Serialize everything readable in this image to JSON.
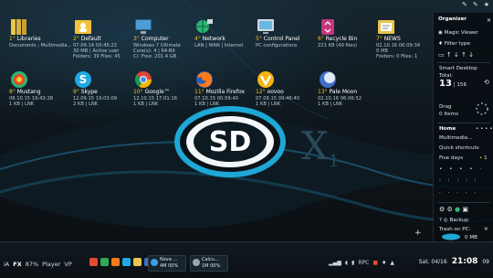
{
  "top_bar": {
    "icons": [
      "pin-icon",
      "pin-icon",
      "star-icon"
    ]
  },
  "desktop_icons": [
    {
      "num": "1°",
      "title": "Libraries",
      "line1": "Documents ; Multimedia...",
      "line2": "",
      "icon": "folder-icon",
      "color": "#e7c64a"
    },
    {
      "num": "2°",
      "title": "Default",
      "line1": "07.09.14  03:45:22",
      "line2": "30 MB  |  Active user",
      "line3": "Folders: 39  Files: 45",
      "icon": "user-folder-icon",
      "color": "#f3c23a"
    },
    {
      "num": "3°",
      "title": "Computer",
      "line1": "Windows 7 Ultimate",
      "line2": "Core(s): 4  |  64-Bit",
      "line3": "C/: Free: 201.4 GB",
      "icon": "computer-icon",
      "color": "#4e9bd6"
    },
    {
      "num": "4°",
      "title": "Network",
      "line1": "LAN | WAN | Internet",
      "line2": "",
      "icon": "network-icon",
      "color": "#2bb673"
    },
    {
      "num": "5°",
      "title": "Control Panel",
      "line1": "PC configurations",
      "line2": "",
      "icon": "control-panel-icon",
      "color": "#6cb6e6"
    },
    {
      "num": "6°",
      "title": "Recycle Bin",
      "line1": "221 KB (49 files)",
      "line2": "",
      "icon": "recycle-bin-icon",
      "color": "#c2377d"
    },
    {
      "num": "7°",
      "title": "NEWS",
      "line1": "02.10.16  06:09:34",
      "line2": "0 MB",
      "line3": "Folders: 0  Files: 1",
      "icon": "news-folder-icon",
      "color": "#e7c64a"
    },
    {
      "num": "8°",
      "title": "Mustang",
      "line1": "08.10.15  19:43:28",
      "line2": "1 KB  |  LNK",
      "icon": "mustang-icon",
      "color": "#e84a2c"
    },
    {
      "num": "9°",
      "title": "Skype",
      "line1": "12.09.15  19:03:09",
      "line2": "2 KB  |  LNK",
      "icon": "skype-icon",
      "color": "#21a7e3"
    },
    {
      "num": "10°",
      "title": "Google™",
      "line1": "12.10.15  17:01:16",
      "line2": "1 KB  |  LNK",
      "icon": "chrome-icon",
      "color": "#34a853"
    },
    {
      "num": "11°",
      "title": "Mozilla Firefox",
      "line1": "07.10.15  00:59:40",
      "line2": "1 KB  |  LNK",
      "icon": "firefox-icon",
      "color": "#ff7a1a"
    },
    {
      "num": "12°",
      "title": "oovoo",
      "line1": "07.09.15  09:46:40",
      "line2": "1 KB  |  LNK",
      "icon": "oovoo-icon",
      "color": "#f5b40f"
    },
    {
      "num": "13°",
      "title": "Pale Moon",
      "line1": "02.10.16  06:06:52",
      "line2": "1 KB  |  LNK",
      "icon": "pale-moon-icon",
      "color": "#3f6fc9"
    }
  ],
  "logo": {
    "letters": "SD",
    "suffix": "X",
    "sub": "1"
  },
  "panel": {
    "organizer": "Organizer",
    "magic_viewer": "Magic Viewer",
    "filter_type": "Filter type",
    "smart_desktop": "Smart Desktop",
    "total_label": "Total:",
    "total_value": "13",
    "total_extra": "| 156",
    "drag": "Drag",
    "drag_items": "0 Items",
    "home": "Home",
    "multimedia": "Multimedia...",
    "quick_shortcuts": "Quick shortcuts",
    "five_days": "Five days",
    "backup": "Backup",
    "trash_label": "Trash on PC:",
    "trash_value": "0 MB"
  },
  "taskbar": {
    "left_items": [
      "iA",
      "FX",
      "87%",
      "Player",
      "VP"
    ],
    "windows": [
      {
        "title": "Nova ...",
        "sub": "4M 00%",
        "color": "#3aa0e0"
      },
      {
        "title": "Calcu...",
        "sub": "1M 00%",
        "color": "#9aa5ad"
      }
    ],
    "tray_text": "RPC",
    "day": "Sat. 04/16",
    "time": "21:08",
    "time_suffix": "09"
  },
  "plus_label": "+"
}
